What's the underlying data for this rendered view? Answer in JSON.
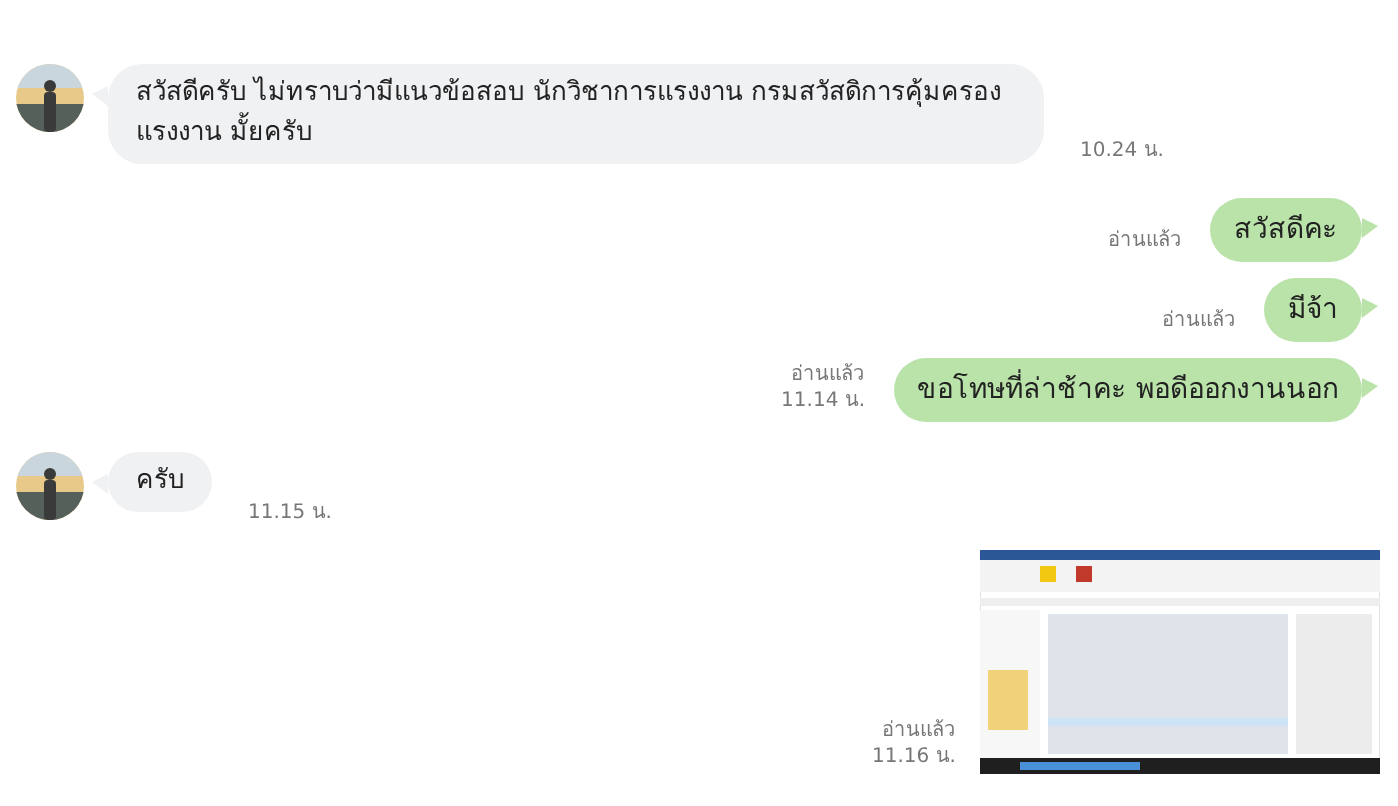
{
  "messages": [
    {
      "kind": "in",
      "text": "สวัสดีครับ ไม่ทราบว่ามีแนวข้อสอบ นักวิชาการแรงงาน กรมสวัสดิการคุ้มครองแรงงาน มั้ยครับ",
      "time": "10.24 น."
    },
    {
      "kind": "out",
      "text": "สวัสดีคะ",
      "read": "อ่านแล้ว"
    },
    {
      "kind": "out",
      "text": "มีจ้า",
      "read": "อ่านแล้ว"
    },
    {
      "kind": "out",
      "text": "ขอโทษที่ล่าช้าคะ พอดีออกงานนอก",
      "read": "อ่านแล้ว",
      "time": "11.14 น."
    },
    {
      "kind": "in",
      "text": "ครับ",
      "time": "11.15 น."
    },
    {
      "read": "อ่านแล้ว",
      "time": "11.16 น."
    }
  ]
}
